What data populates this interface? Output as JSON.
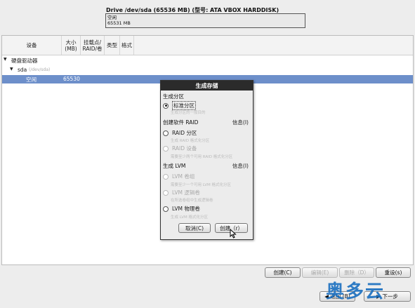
{
  "drive": {
    "title": "Drive /dev/sda (65536 MB) (型号: ATA VBOX HARDDISK)",
    "bar_label": "空闲",
    "bar_size": "65531 MB"
  },
  "table": {
    "headers": {
      "device": "设备",
      "size": "大小\n(MB)",
      "mount": "挂载点/\nRAID/卷",
      "type": "类型",
      "format": "格式"
    },
    "group": "硬盘驱动器",
    "disk": "sda",
    "disk_path": "(/dev/sda)",
    "free_label": "空闲",
    "free_size": "65530"
  },
  "dialog": {
    "title": "生成存储",
    "section_partition": "生成分区",
    "std_partition": "标准分区",
    "std_partition_desc": "生成分区的一般目的",
    "section_raid": "创建软件 RAID",
    "raid_info": "信息(I)",
    "raid_partition": "RAID 分区",
    "raid_partition_desc": "生成 RAID 格式化分区",
    "raid_device": "RAID 设备",
    "raid_device_desc": "需要至少两个可用 RAID 格式化分区",
    "section_lvm": "生成 LVM",
    "lvm_info": "信息(I)",
    "lvm_group": "LVM 卷组",
    "lvm_group_desc": "需要至少一个可用 LVM 格式化分区",
    "lvm_lv": "LVM 逻辑卷",
    "lvm_lv_desc": "在所选卷组中生成逻辑卷",
    "lvm_pv": "LVM 物理卷",
    "lvm_pv_desc": "生成 LVM 格式化分区",
    "cancel": "取消(C)",
    "create": "创建（r）"
  },
  "toolbar": {
    "create": "创建(C)",
    "edit": "编辑(E)",
    "delete": "删除（D）",
    "reset": "重设(s)"
  },
  "nav": {
    "back": "返回 (B)",
    "next": "下一步"
  },
  "watermark": "奥多云"
}
